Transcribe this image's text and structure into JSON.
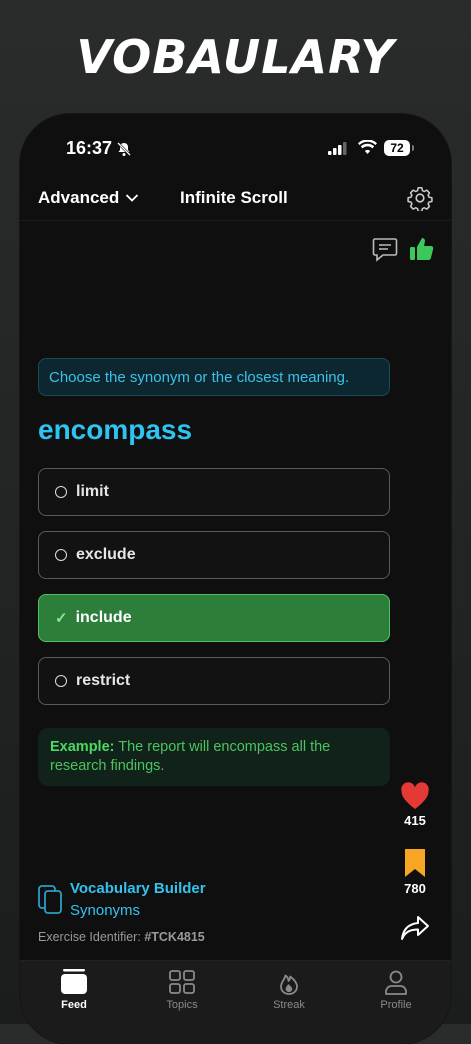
{
  "brand": {
    "title": "VOBAULARY"
  },
  "status_bar": {
    "time": "16:37",
    "battery": "72"
  },
  "header": {
    "level": "Advanced",
    "feed_title": "Infinite Scroll"
  },
  "question": {
    "prompt": "Choose the synonym or the closest meaning.",
    "word": "encompass",
    "options": [
      {
        "label": "limit",
        "state": "unselected"
      },
      {
        "label": "exclude",
        "state": "unselected"
      },
      {
        "label": "include",
        "state": "correct"
      },
      {
        "label": "restrict",
        "state": "unselected"
      }
    ],
    "example_label": "Example:",
    "example_text": "The report will encompass all the research findings."
  },
  "actions": {
    "likes": "415",
    "bookmarks": "780"
  },
  "footer": {
    "category": "Vocabulary Builder",
    "subcategory": "Synonyms",
    "exercise_label": "Exercise Identifier:",
    "exercise_id": "#TCK4815"
  },
  "tabs": [
    {
      "label": "Feed",
      "icon": "feed-icon",
      "active": true
    },
    {
      "label": "Topics",
      "icon": "grid-icon",
      "active": false
    },
    {
      "label": "Streak",
      "icon": "flame-icon",
      "active": false
    },
    {
      "label": "Profile",
      "icon": "person-icon",
      "active": false
    }
  ],
  "colors": {
    "accent_blue": "#2ec3f0",
    "correct_green": "#2d7d3b",
    "like_red": "#e53935",
    "bookmark_orange": "#f6a623"
  }
}
